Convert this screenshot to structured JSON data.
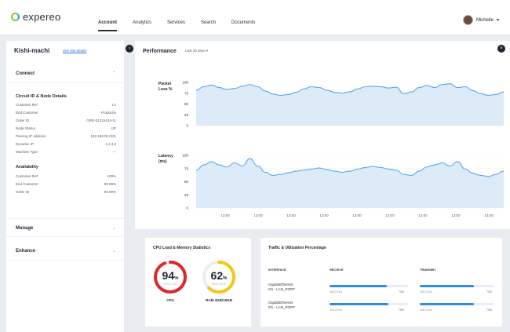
{
  "app": {
    "brand": "expereo",
    "nav": [
      "Account",
      "Analytics",
      "Services",
      "Search",
      "Documents"
    ],
    "active_nav": "Account",
    "user_name": "Michelle"
  },
  "sidebar": {
    "site_name": "Kishi-machi",
    "site_link": "See site details",
    "sections": {
      "connect": "Connect",
      "manage": "Manage",
      "enhance": "Enhance"
    },
    "circuit": {
      "title": "Circuit ID & Node Details",
      "rows": [
        {
          "k": "Customer Ref",
          "v": "L1"
        },
        {
          "k": "End Customer",
          "v": "Productie"
        },
        {
          "k": "Order ID",
          "v": "ORD-01215434-11"
        },
        {
          "k": "Node Status",
          "v": "UP"
        },
        {
          "k": "Peering IP Address",
          "v": "192.168.00.0/21"
        },
        {
          "k": "Dynamic IP",
          "v": "1.2.3.2"
        },
        {
          "k": "Machine Type",
          "v": "---"
        }
      ]
    },
    "availability": {
      "title": "Availability",
      "rows": [
        {
          "k": "Customer Ref",
          "v": "100%"
        },
        {
          "k": "End Customer",
          "v": "99.99%"
        },
        {
          "k": "Order ID",
          "v": "99.99%"
        }
      ]
    }
  },
  "performance": {
    "title": "Performance",
    "range_select": "Last 30 days ▾",
    "packet_loss_label": "Packet Loss %",
    "latency_label": "Latency (ms)",
    "y_ticks": [
      "100",
      "75",
      "50",
      "25",
      "0"
    ],
    "x_ticks": [
      "13:00",
      "13:00",
      "13:00",
      "13:00",
      "13:00",
      "13:00",
      "13:00",
      "13:00",
      "13:00"
    ]
  },
  "chart_data": [
    {
      "type": "area",
      "ylabel": "Packet Loss %",
      "ylim": [
        0,
        100
      ],
      "x": [
        0,
        1,
        2,
        3,
        4,
        5,
        6,
        7,
        8,
        9,
        10,
        11,
        12,
        13,
        14,
        15,
        16,
        17,
        18,
        19,
        20,
        21,
        22,
        23,
        24,
        25,
        26,
        27,
        28,
        29,
        30,
        31,
        32,
        33,
        34,
        35,
        36,
        37,
        38,
        39,
        40
      ],
      "values": [
        82,
        90,
        94,
        88,
        84,
        86,
        91,
        95,
        90,
        80,
        73,
        70,
        72,
        77,
        85,
        90,
        88,
        82,
        77,
        75,
        78,
        85,
        90,
        91,
        90,
        87,
        89,
        74,
        78,
        88,
        93,
        88,
        95,
        97,
        88,
        90,
        81,
        74,
        70,
        72,
        78
      ]
    },
    {
      "type": "area",
      "ylabel": "Latency (ms)",
      "ylim": [
        0,
        100
      ],
      "x": [
        0,
        1,
        2,
        3,
        4,
        5,
        6,
        7,
        8,
        9,
        10,
        11,
        12,
        13,
        14,
        15,
        16,
        17,
        18,
        19,
        20,
        21,
        22,
        23,
        24,
        25,
        26,
        27,
        28,
        29,
        30,
        31,
        32,
        33,
        34,
        35,
        36,
        37,
        38,
        39,
        40
      ],
      "values": [
        72,
        82,
        88,
        82,
        78,
        86,
        80,
        94,
        80,
        68,
        62,
        64,
        67,
        70,
        72,
        74,
        76,
        73,
        70,
        68,
        70,
        74,
        77,
        79,
        77,
        74,
        72,
        64,
        62,
        70,
        78,
        82,
        86,
        80,
        88,
        74,
        66,
        62,
        60,
        64,
        70
      ]
    }
  ],
  "cpu_card": {
    "title": "CPU Load & Memory Statistics",
    "cpu_value": "94",
    "cpu_unit": "%",
    "cpu_sub": "CPU LOAD",
    "cpu_caption": "CPU",
    "cpu_fraction": 0.94,
    "ram_value": "62",
    "ram_unit": "%",
    "ram_sub": "RAM USED",
    "ram_caption": "RAM 4GB/16GB",
    "ram_fraction": 0.62,
    "cpu_color": "#e0262c",
    "ram_color": "#f5c518"
  },
  "traffic_card": {
    "title": "Traffic & Utilization Percentage",
    "headers": {
      "interface": "INTERFACE",
      "receive": "RECEIVE",
      "transmit": "TRANSMIT"
    },
    "rows": [
      {
        "iface1": "GigabitEthernet",
        "iface2": "0/1 - LAN_PORT",
        "rx_small": "445.23 Kb",
        "rx_pct": "73%",
        "rx_fraction": 0.73,
        "tx_small": "445.23 Kb",
        "tx_pct": "73%",
        "tx_fraction": 0.73
      },
      {
        "iface1": "GigabitEthernet",
        "iface2": "0/1 - LAN_PORT",
        "rx_small": "445.23 Kb",
        "rx_pct": "75%",
        "rx_fraction": 0.75,
        "tx_small": "445.23 Kb",
        "tx_pct": "73%",
        "tx_fraction": 0.73
      }
    ]
  },
  "colors": {
    "accent": "#2a8dea",
    "chart_fill": "#d7e8f8",
    "chart_line": "#5aa6e8",
    "brand_green": "#8cc63f"
  }
}
